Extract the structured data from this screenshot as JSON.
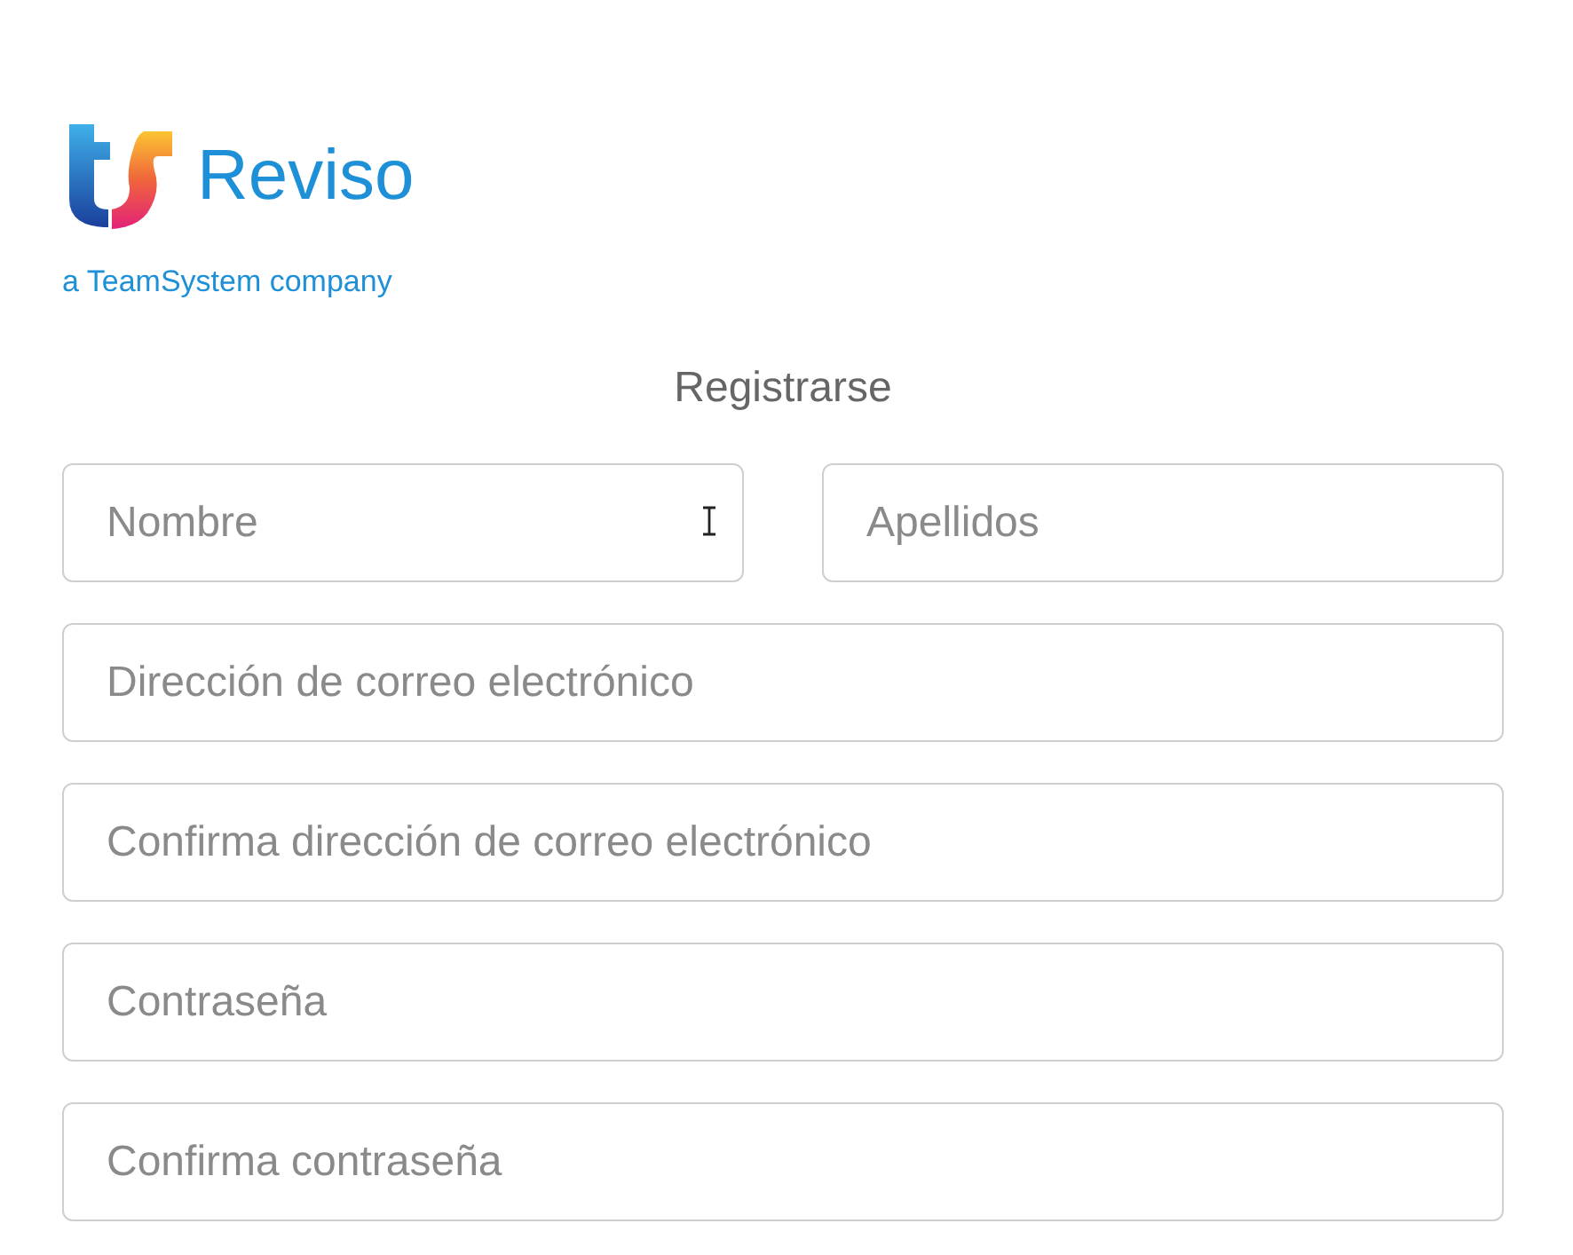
{
  "logo": {
    "name": "Reviso",
    "tagline": "a TeamSystem company"
  },
  "form": {
    "title": "Registrarse",
    "rows": [
      [
        {
          "placeholder": "Nombre",
          "pointer": true
        },
        {
          "placeholder": "Apellidos",
          "pointer": false
        }
      ],
      [
        {
          "placeholder": "Dirección de correo electrónico",
          "pointer": false
        }
      ],
      [
        {
          "placeholder": "Confirma dirección de correo electrónico",
          "pointer": false
        }
      ],
      [
        {
          "placeholder": "Contraseña",
          "pointer": false
        }
      ],
      [
        {
          "placeholder": "Confirma contraseña",
          "pointer": false
        }
      ]
    ]
  }
}
